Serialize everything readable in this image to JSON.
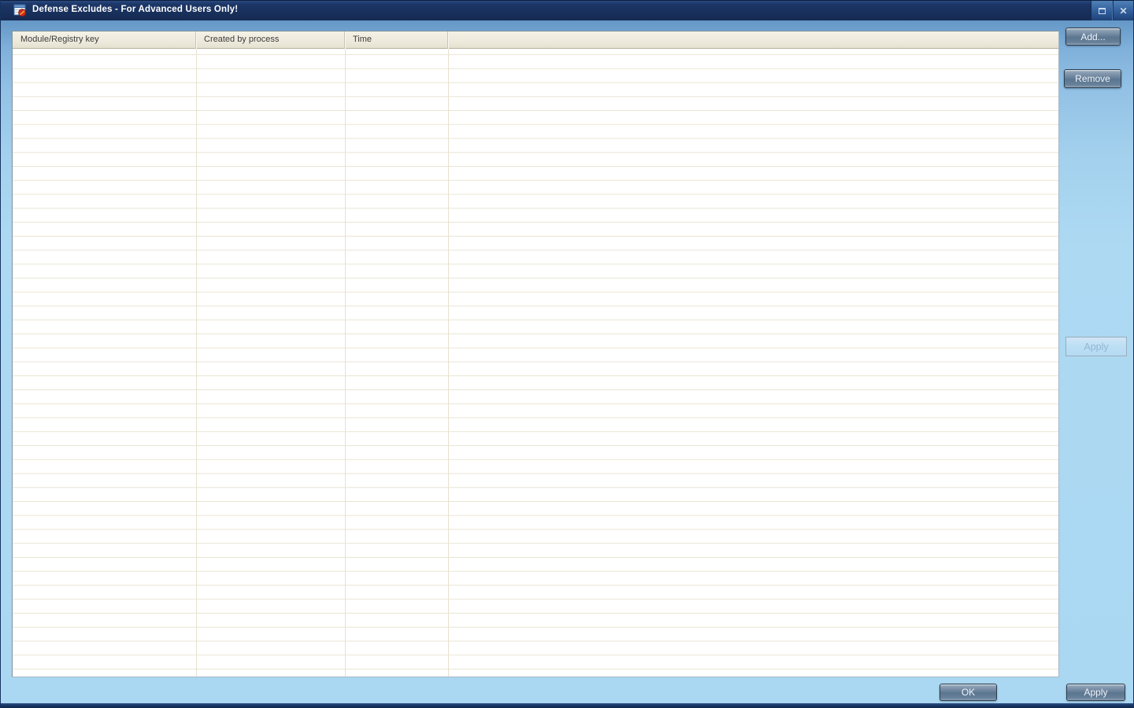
{
  "window": {
    "title": "Defense Excludes - For Advanced Users Only!",
    "controls": {
      "close_glyph": "✕"
    }
  },
  "table": {
    "columns": [
      {
        "label": "Module/Registry key"
      },
      {
        "label": "Created by process"
      },
      {
        "label": "Time"
      },
      {
        "label": ""
      }
    ],
    "rows": []
  },
  "side_panel": {
    "add_label": "Add...",
    "remove_label": "Remove",
    "apply_label": "Apply"
  },
  "footer": {
    "ok_label": "OK",
    "apply_label": "Apply"
  },
  "colors": {
    "titlebar": "#18305c",
    "content_gradient_top": "#6497c6",
    "content_gradient_bottom": "#aad7f1",
    "list_header_bg": "#ece8da",
    "grid_line": "#e9e5d3",
    "button_face": "#68809a",
    "badge_red": "#cc2a1e"
  }
}
